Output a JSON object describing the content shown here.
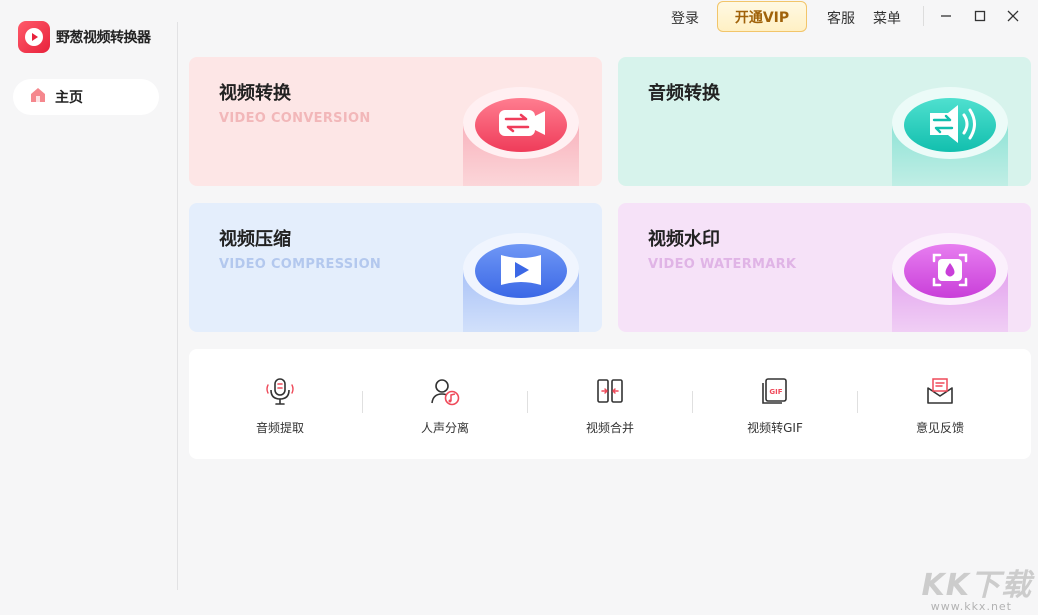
{
  "app": {
    "title": "野葱视频转换器"
  },
  "sidebar": {
    "home_label": "主页"
  },
  "topbar": {
    "login": "登录",
    "vip": "开通VIP",
    "service": "客服",
    "menu": "菜单"
  },
  "cards": [
    {
      "title": "视频转换",
      "subtitle": "VIDEO CONVERSION"
    },
    {
      "title": "音频转换",
      "subtitle": ""
    },
    {
      "title": "视频压缩",
      "subtitle": "VIDEO COMPRESSION"
    },
    {
      "title": "视频水印",
      "subtitle": "VIDEO WATERMARK"
    }
  ],
  "tools": [
    {
      "label": "音频提取",
      "icon": "mic-icon"
    },
    {
      "label": "人声分离",
      "icon": "voice-separate-icon"
    },
    {
      "label": "视频合并",
      "icon": "merge-icon"
    },
    {
      "label": "视频转GIF",
      "icon": "gif-icon"
    },
    {
      "label": "意见反馈",
      "icon": "feedback-icon"
    }
  ],
  "watermark": {
    "main": "KK下载",
    "url": "www.kkx.net"
  },
  "colors": {
    "brand": "#e8213b",
    "vip_text": "#a0620a"
  }
}
